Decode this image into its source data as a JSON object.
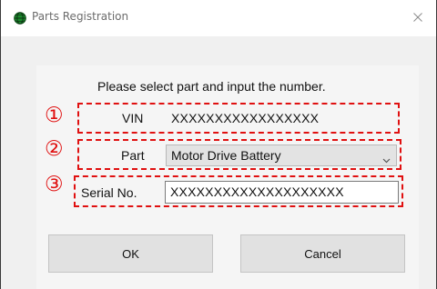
{
  "window": {
    "title": "Parts Registration",
    "close_glyph": "✕"
  },
  "form": {
    "instruction": "Please select part and input the number.",
    "markers": [
      "①",
      "②",
      "③"
    ],
    "vin": {
      "label": "VIN",
      "value": "XXXXXXXXXXXXXXXXX"
    },
    "part": {
      "label": "Part",
      "selected": "Motor Drive Battery"
    },
    "serial": {
      "label": "Serial No.",
      "value": "XXXXXXXXXXXXXXXXXXXX"
    }
  },
  "buttons": {
    "ok_label": "OK",
    "cancel_label": "Cancel"
  },
  "colors": {
    "annotation_red": "#e01010",
    "client_bg": "#f0f0f0",
    "select_bg": "#e3e3e3"
  },
  "icons": {
    "app": "globe-app-icon",
    "close": "close-icon",
    "dropdown": "chevron-down-icon"
  }
}
